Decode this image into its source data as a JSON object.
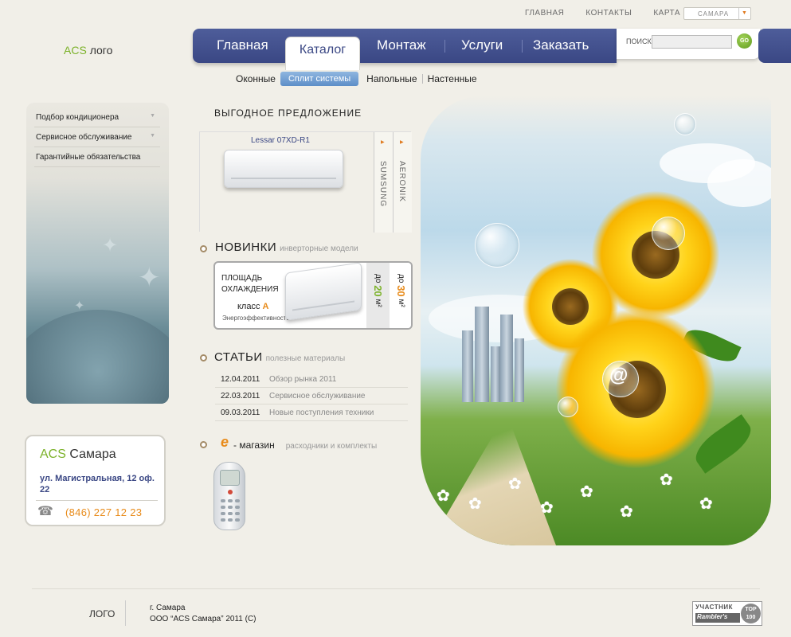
{
  "top_links": [
    "ГЛАВНАЯ",
    "КОНТАКТЫ",
    "КАРТА"
  ],
  "city_select": {
    "value": "САМАРА"
  },
  "logo": {
    "brand": "ACS",
    "text": "лого"
  },
  "nav": {
    "items": [
      "Главная",
      "Каталог",
      "Монтаж",
      "Услуги",
      "Заказать"
    ],
    "active": "Каталог"
  },
  "search": {
    "label": "ПОИСК",
    "placeholder": "",
    "go": "GO"
  },
  "subnav": {
    "items": [
      "Оконные",
      "Сплит системы",
      "Напольные",
      "Настенные"
    ],
    "active": "Сплит системы"
  },
  "sidebar": {
    "items": [
      {
        "label": "Подбор кондиционера"
      },
      {
        "label": "Сервисное обслуживание"
      },
      {
        "label": "Гарантийные обязательства"
      }
    ]
  },
  "contact": {
    "brand": "ACS",
    "city": "Самара",
    "address": "ул. Магистральная, 12 оф. 22",
    "phone": "(846) 227 12 23"
  },
  "offer": {
    "title": "ВЫГОДНОЕ ПРЕДЛОЖЕНИЕ",
    "product": "Lessar 07XD-R1",
    "brands": [
      "SUMSUNG",
      "AERONIK"
    ]
  },
  "news": {
    "title": "НОВИНКИ",
    "subtitle": "инверторные модели",
    "area_label": "ПЛОЩАДЬ ОХЛАЖДЕНИЯ",
    "class_label": "класс",
    "class_value": "А",
    "energy": "Энергоэффективность",
    "col1": {
      "prefix": "до",
      "value": "20",
      "unit": "м²"
    },
    "col2": {
      "prefix": "до",
      "value": "30",
      "unit": "м²"
    }
  },
  "articles": {
    "title": "СТАТЬИ",
    "subtitle": "полезные материалы",
    "rows": [
      {
        "date": "12.04.2011",
        "text": "Обзор рынка 2011"
      },
      {
        "date": "22.03.2011",
        "text": "Сервисное обслуживание"
      },
      {
        "date": "09.03.2011",
        "text": "Новые поступления техники"
      }
    ]
  },
  "shop": {
    "prefix": "e",
    "title": "- магазин",
    "subtitle": "расходники и комплекты"
  },
  "footer": {
    "logo": "ЛОГО",
    "city": "г. Самара",
    "copyright": "ООО “ACS Самара”  2011 (С)",
    "rambler_top": "УЧАСТНИК",
    "rambler_name": "Rambler's",
    "rambler_badge": "TOP 100"
  },
  "colors": {
    "nav": "#3a4784",
    "accent_green": "#7cb22a",
    "accent_orange": "#e88b1a",
    "background": "#f1efe8"
  }
}
